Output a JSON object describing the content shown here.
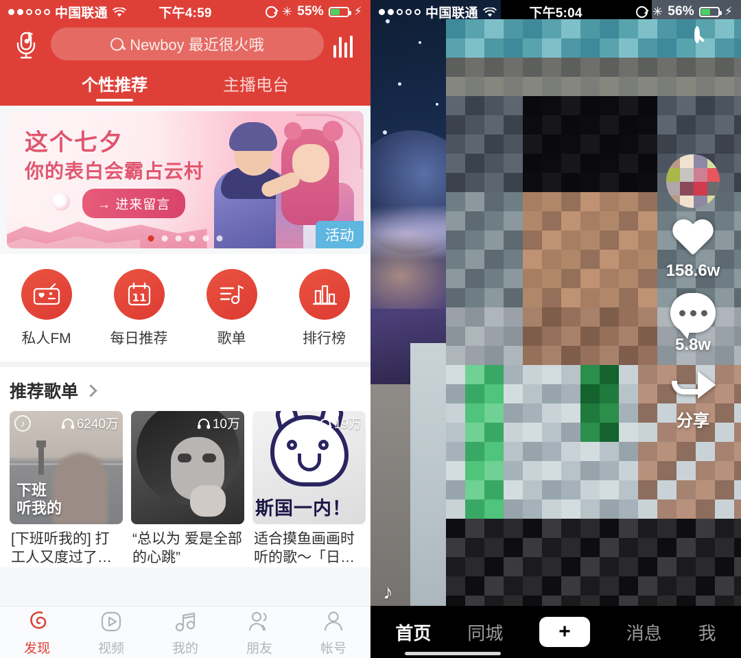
{
  "left_app": {
    "name": "NetEase Cloud Music",
    "accent_color": "#de4038",
    "status_bar": {
      "carrier": "中国联通",
      "time": "下午4:59",
      "battery_pct": "55%",
      "signal_dots_filled": 2,
      "signal_dots_total": 5
    },
    "header": {
      "mic_icon": "mic-note-icon",
      "search_placeholder": "Newboy 最近很火哦",
      "search_icon": "search-icon",
      "equalizer_icon": "equalizer-icon"
    },
    "tabs": [
      {
        "label": "个性推荐",
        "active": true
      },
      {
        "label": "主播电台",
        "active": false
      }
    ],
    "banner": {
      "title": "这个七夕",
      "subtitle": "你的表白会霸占云村",
      "button": "→ 进来留言",
      "tag": "活动",
      "dots_total": 6,
      "dots_active_index": 0
    },
    "quick_entries": [
      {
        "label": "私人FM",
        "icon": "radio-heart-icon"
      },
      {
        "label": "每日推荐",
        "icon": "calendar-icon",
        "badge": "11"
      },
      {
        "label": "歌单",
        "icon": "playlist-note-icon"
      },
      {
        "label": "排行榜",
        "icon": "bar-chart-icon"
      }
    ],
    "section": {
      "title": "推荐歌单",
      "chevron_icon": "chevron-right-icon"
    },
    "playlists": [
      {
        "plays": "6240万",
        "headphone_icon": "headphone-icon",
        "logo_icon": "netease-logo-icon",
        "cover_text": "下班\n听我的",
        "title": "[下班听我的] 打工人又度过了…"
      },
      {
        "plays": "10万",
        "headphone_icon": "headphone-icon",
        "cover_text": "",
        "title": "“总以为 爱是全部的心跳”"
      },
      {
        "plays": "19万",
        "headphone_icon": "headphone-icon",
        "cover_text": "斯国一内！",
        "title": "适合摸鱼画画时听的歌～「日…"
      }
    ],
    "bottom_nav": [
      {
        "label": "发现",
        "icon": "netease-logo-icon",
        "active": true
      },
      {
        "label": "视频",
        "icon": "play-video-icon",
        "active": false
      },
      {
        "label": "我的",
        "icon": "music-note-icon",
        "active": false
      },
      {
        "label": "朋友",
        "icon": "friends-icon",
        "active": false
      },
      {
        "label": "帐号",
        "icon": "account-icon",
        "active": false
      }
    ]
  },
  "right_app": {
    "name": "Douyin",
    "status_bar": {
      "carrier": "中国联通",
      "time": "下午5:04",
      "battery_pct": "56%",
      "signal_dots_filled": 2,
      "signal_dots_total": 5
    },
    "search_icon": "search-icon",
    "rail": {
      "avatar_icon": "avatar",
      "like_icon": "heart-icon",
      "like_count": "158.6w",
      "comment_icon": "comment-icon",
      "comment_count": "5.8w",
      "share_icon": "share-arrow-icon",
      "share_label": "分享"
    },
    "music_note_icon": "music-note-icon",
    "bottom_nav": [
      {
        "label": "首页",
        "active": true
      },
      {
        "label": "同城",
        "active": false
      },
      {
        "label": "+",
        "active": false,
        "is_plus": true
      },
      {
        "label": "消息",
        "active": false
      },
      {
        "label": "我",
        "active": false
      }
    ]
  }
}
